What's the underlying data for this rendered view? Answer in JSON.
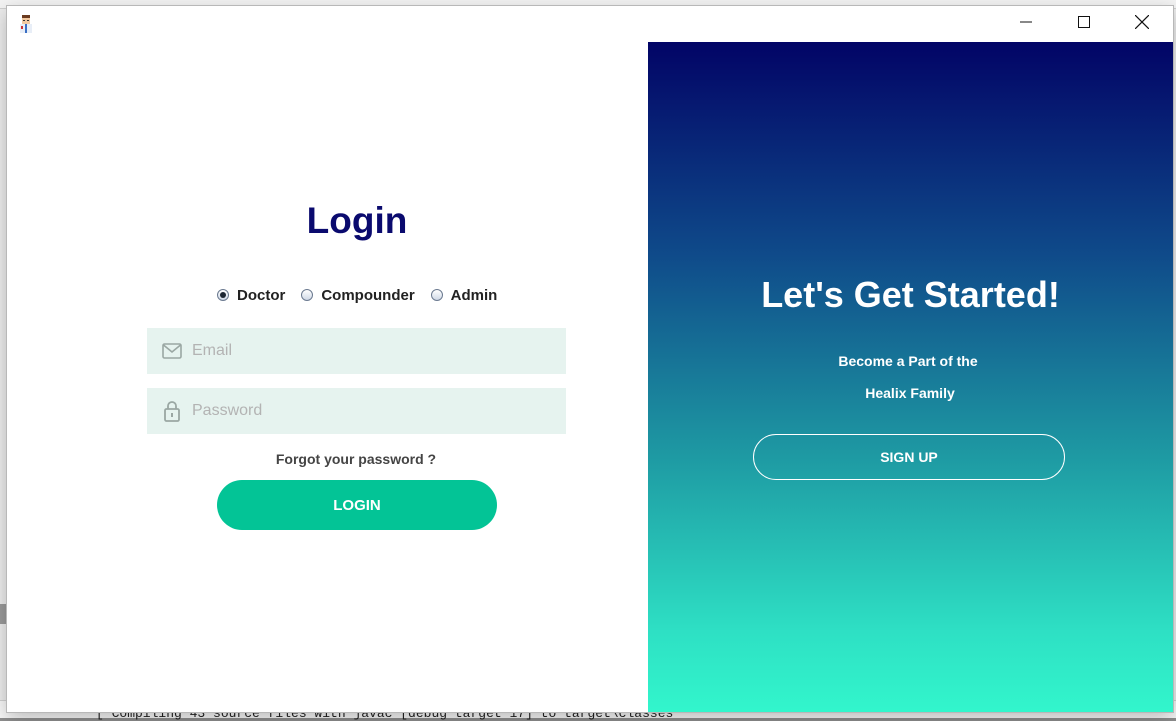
{
  "background": {
    "console_text": "[ Compiling 43 source files with javac [debug target 17] to target\\classes"
  },
  "window": {
    "app_icon": "doctor-avatar-icon",
    "controls": {
      "minimize": "minimize-icon",
      "maximize": "maximize-icon",
      "close": "close-icon"
    }
  },
  "login": {
    "title": "Login",
    "roles": [
      {
        "label": "Doctor",
        "checked": true
      },
      {
        "label": "Compounder",
        "checked": false
      },
      {
        "label": "Admin",
        "checked": false
      }
    ],
    "email": {
      "placeholder": "Email",
      "value": "",
      "icon": "mail-icon"
    },
    "password": {
      "placeholder": "Password",
      "value": "",
      "icon": "lock-icon"
    },
    "forgot_label": "Forgot your password ?",
    "button_label": "LOGIN"
  },
  "signup": {
    "title": "Let's Get Started!",
    "subtitle_line1": "Become a Part of the",
    "subtitle_line2": "Healix Family",
    "button_label": "SIGN UP"
  },
  "colors": {
    "title": "#0a0a6e",
    "field_bg": "#e6f3ef",
    "login_button": "#03c496",
    "gradient_top": "#020466",
    "gradient_bottom": "#32f6cc"
  }
}
